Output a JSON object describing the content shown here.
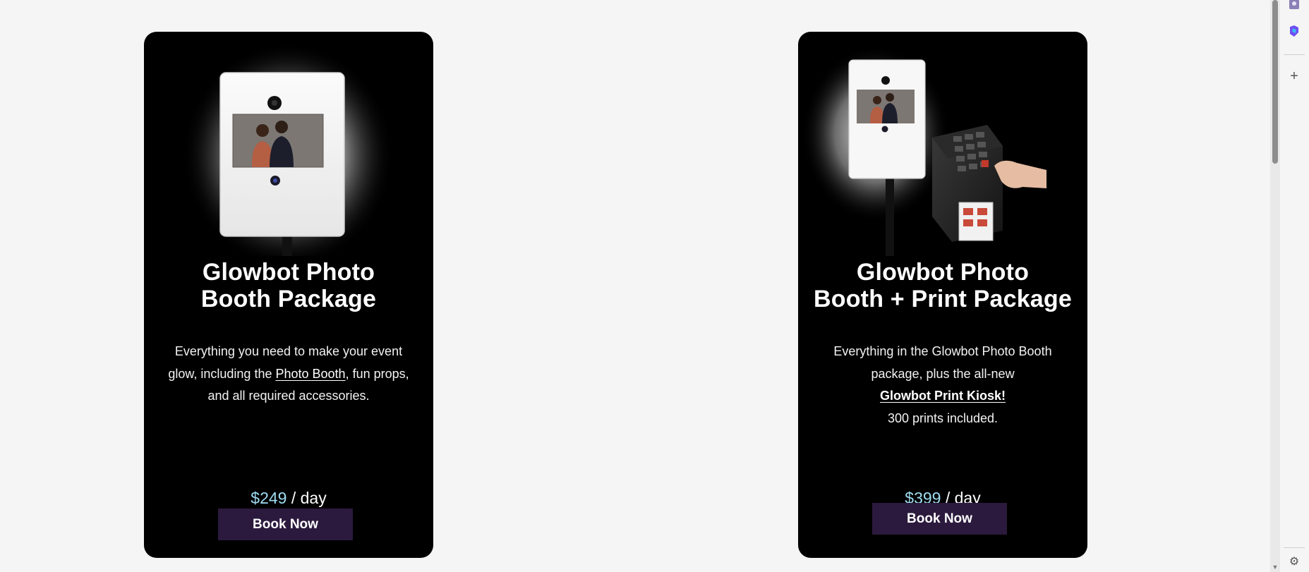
{
  "cards": [
    {
      "title_line1": "Glowbot Photo",
      "title_line2": "Booth Package",
      "desc_part1": "Everything you need to make your event glow, including the ",
      "desc_link": "Photo Booth",
      "desc_part2": ", fun props, and all required accessories.",
      "price_amount": "$249",
      "price_unit": " / day",
      "button_label": "Book Now",
      "image_icon": "photo-booth-image"
    },
    {
      "title_line1": "Glowbot Photo",
      "title_line2": "Booth + Print Package",
      "desc_line1": "Everything in the Glowbot Photo Booth",
      "desc_line2": "package, plus the all-new",
      "desc_link": "Glowbot Print Kiosk!",
      "desc_line4": "300 prints included.",
      "price_amount": "$399",
      "price_unit": " / day",
      "button_label": "Book Now",
      "image_icon": "photo-booth-print-kiosk-image"
    }
  ],
  "sidebar": {
    "icons": [
      "profile-icon",
      "copilot-icon",
      "add-icon",
      "settings-icon"
    ],
    "add_glyph": "+",
    "settings_glyph": "⚙"
  },
  "colors": {
    "page_background": "#f5f5f5",
    "card_background": "#000000",
    "price_accent": "#9fdcf2",
    "button_background": "#2b1a3d"
  }
}
